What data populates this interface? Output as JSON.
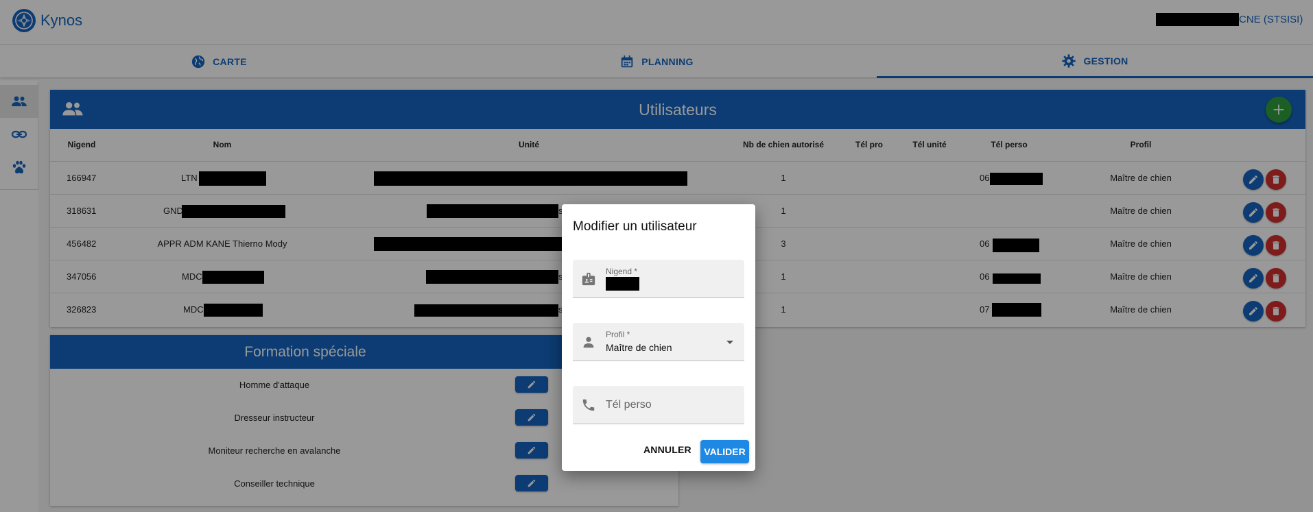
{
  "app": {
    "title": "Kynos",
    "user_label": "CNE (STSISI)"
  },
  "tabs": [
    {
      "label": "CARTE",
      "icon": "globe-icon"
    },
    {
      "label": "PLANNING",
      "icon": "calendar-icon"
    },
    {
      "label": "GESTION",
      "icon": "gear-icon",
      "active": true
    }
  ],
  "rail": [
    "users-icon",
    "link-icon",
    "paw-icon"
  ],
  "users": {
    "title": "Utilisateurs",
    "columns": [
      "Nigend",
      "Nom",
      "Unité",
      "Nb de chien autorisé",
      "Tél pro",
      "Tél unité",
      "Tél perso",
      "Profil"
    ],
    "rows": [
      {
        "nigend": "166947",
        "nom": "LTN",
        "nb": "1",
        "tel_perso": "06",
        "profil": "Maître de chien"
      },
      {
        "nigend": "318631",
        "nom": "GND",
        "unite_suffix": "s",
        "nb": "1",
        "tel_perso": "",
        "profil": "Maître de chien"
      },
      {
        "nigend": "456482",
        "nom": "APPR ADM KANE Thierno Mody",
        "nb": "3",
        "tel_perso": "06",
        "profil": "Maître de chien"
      },
      {
        "nigend": "347056",
        "nom": "MDC",
        "unite_suffix": "s",
        "nb": "1",
        "tel_perso": "06",
        "profil": "Maître de chien"
      },
      {
        "nigend": "326823",
        "nom": "MDC",
        "unite_suffix": "s",
        "nb": "1",
        "tel_perso": "07",
        "profil": "Maître de chien"
      }
    ]
  },
  "formation": {
    "title": "Formation spéciale",
    "items": [
      "Homme d'attaque",
      "Dresseur instructeur",
      "Moniteur recherche en avalanche",
      "Conseiller technique"
    ]
  },
  "dialog": {
    "title": "Modifier un utilisateur",
    "nigend_label": "Nigend *",
    "profil_label": "Profil *",
    "profil_value": "Maître de chien",
    "tel_placeholder": "Tél perso",
    "cancel_label": "ANNULER",
    "ok_label": "VALIDER"
  },
  "colors": {
    "primary": "#1565c0",
    "success": "#2e9e3e",
    "danger": "#d32f2f"
  }
}
